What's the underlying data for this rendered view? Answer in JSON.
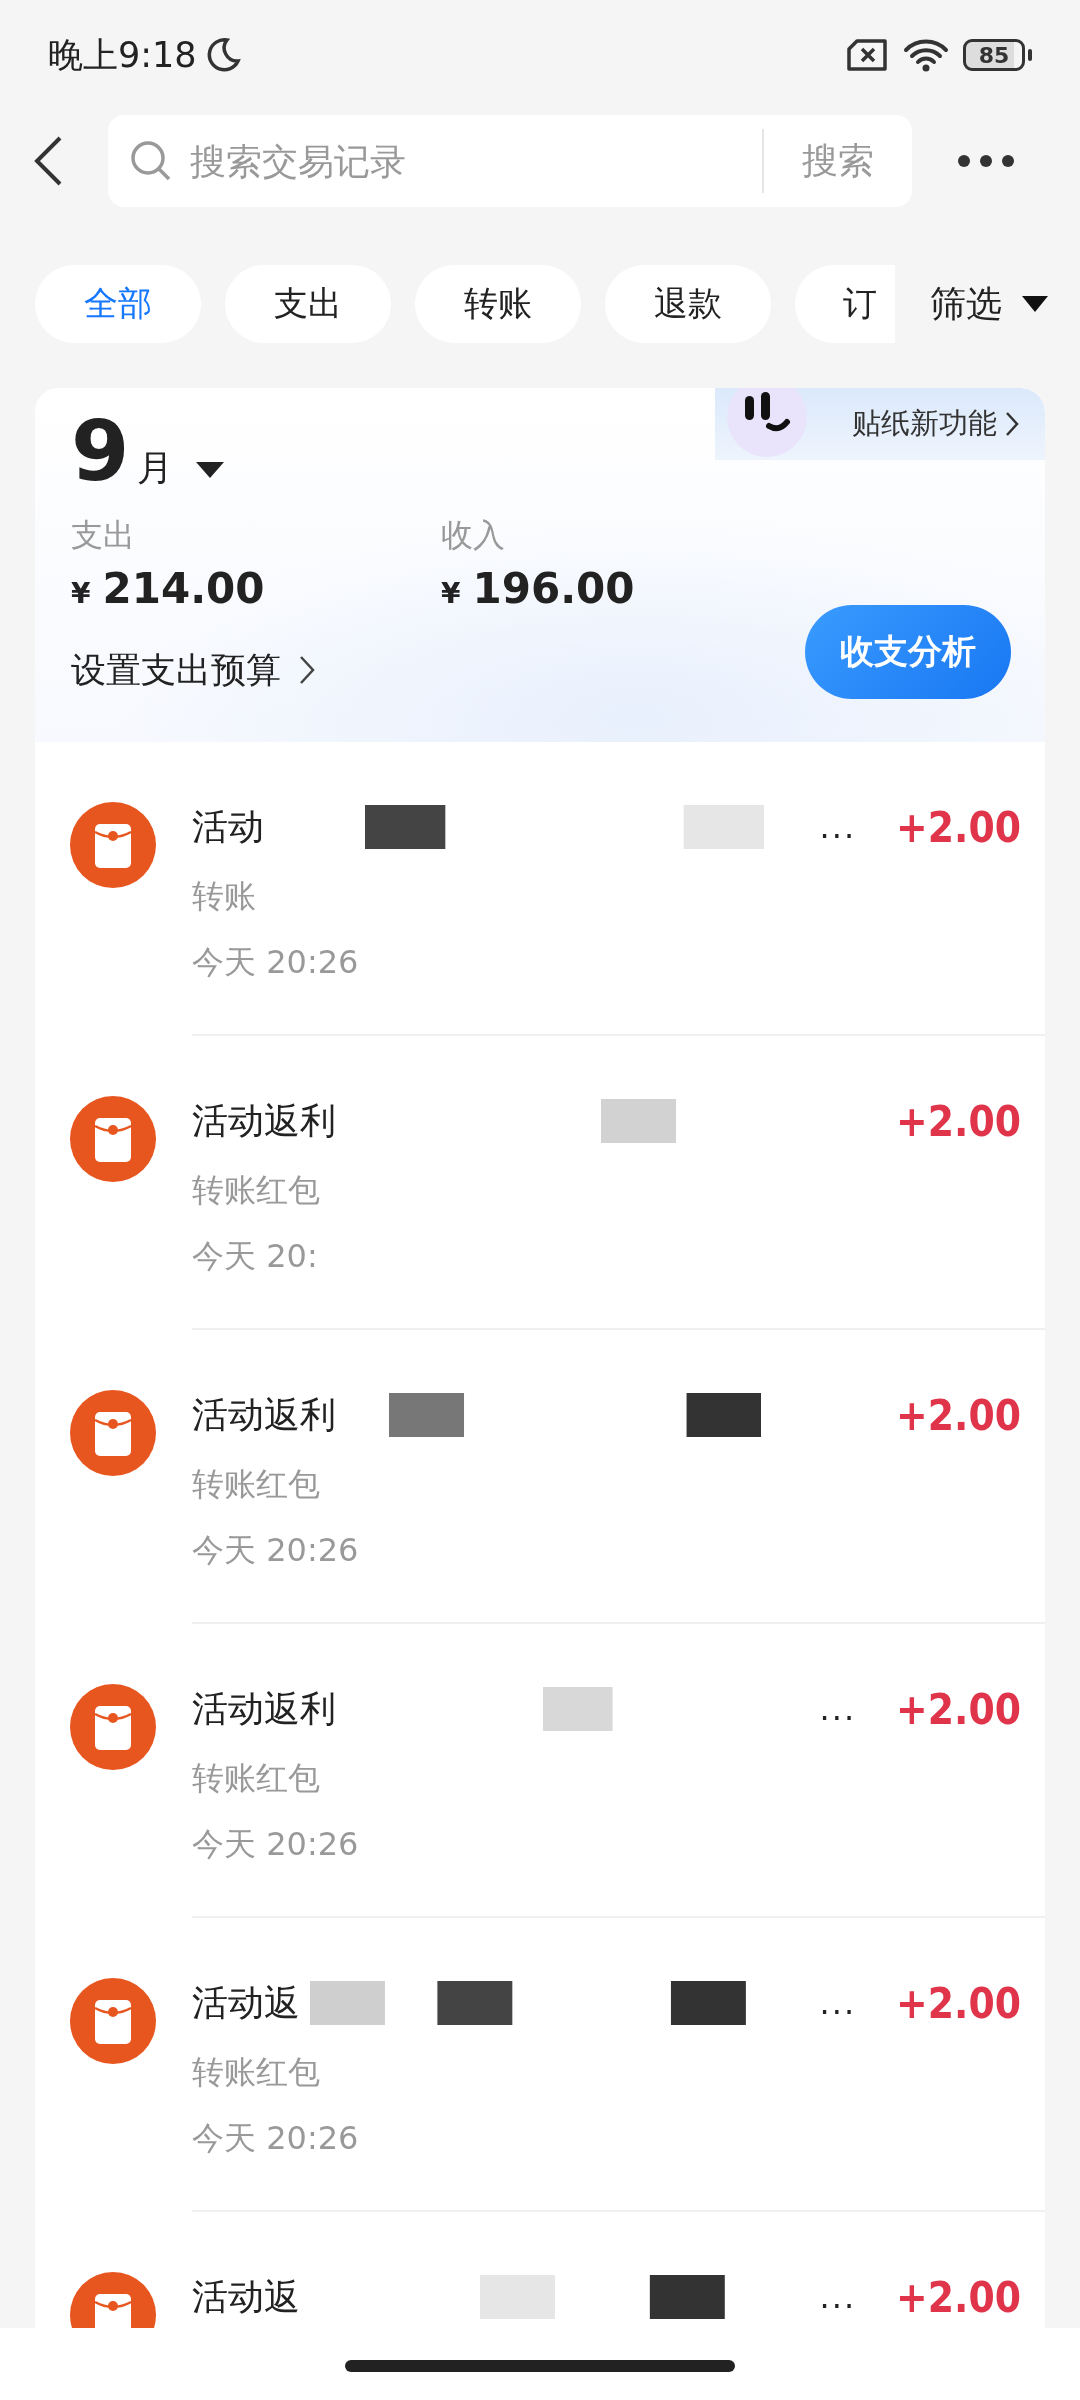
{
  "status_bar": {
    "time": "晚上9:18",
    "battery": "85"
  },
  "search": {
    "placeholder": "搜索交易记录",
    "button": "搜索"
  },
  "filters": [
    {
      "label": "全部",
      "selected": true
    },
    {
      "label": "支出",
      "selected": false
    },
    {
      "label": "转账",
      "selected": false
    },
    {
      "label": "退款",
      "selected": false
    },
    {
      "label": "订",
      "selected": false
    }
  ],
  "filter_button": "筛选",
  "summary": {
    "month": "9",
    "month_unit": "月",
    "badge": "贴纸新功能",
    "expense_label": "支出",
    "expense_currency": "¥",
    "expense": "214.00",
    "income_label": "收入",
    "income_currency": "¥",
    "income": "196.00",
    "budget_link": "设置支出预算",
    "analysis_button": "收支分析"
  },
  "transactions": [
    {
      "title": "活动",
      "trail": "...",
      "subtitle": "转账",
      "time": "今天 20:26",
      "amount": "+2.00"
    },
    {
      "title": "活动返利",
      "subtitle": "转账红包",
      "time": "今天 20:",
      "amount": "+2.00"
    },
    {
      "title": "活动返利",
      "subtitle": "转账红包",
      "time": "今天 20:26",
      "amount": "+2.00"
    },
    {
      "title": "活动返利",
      "trail": "...",
      "subtitle": "转账红包",
      "time": "今天 20:26",
      "amount": "+2.00"
    },
    {
      "title": "活动返",
      "trail": "...",
      "subtitle": "转账红包",
      "time": "今天 20:26",
      "amount": "+2.00"
    },
    {
      "title": "活动返",
      "trail": "...",
      "amount": "+2.00"
    }
  ]
}
